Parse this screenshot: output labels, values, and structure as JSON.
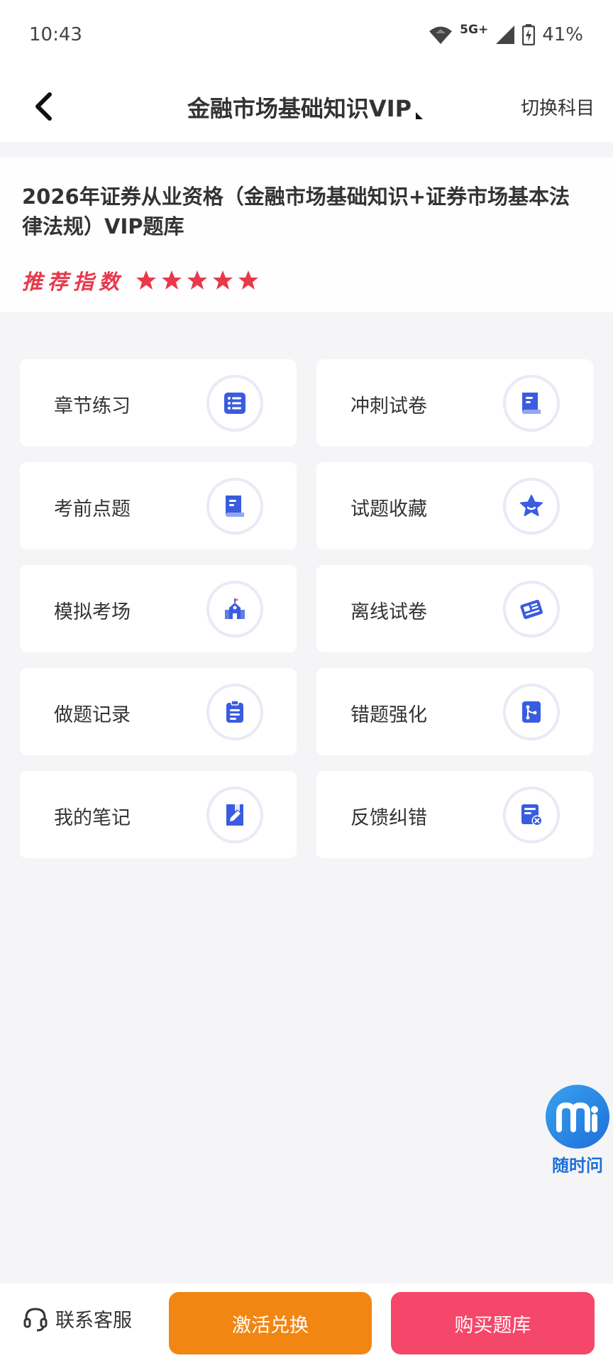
{
  "status_bar": {
    "time": "10:43",
    "network": "5G+",
    "battery": "41%"
  },
  "nav": {
    "title": "金融市场基础知识VIP",
    "switch_label": "切换科目"
  },
  "header": {
    "bank_title": "2026年证券从业资格（金融市场基础知识+证券市场基本法律法规）VIP题库",
    "rating_label": "推荐指数",
    "rating_stars": 5,
    "accent_color": "#e8394b"
  },
  "tiles": [
    {
      "label": "章节练习",
      "icon": "list-icon"
    },
    {
      "label": "冲刺试卷",
      "icon": "document-icon"
    },
    {
      "label": "考前点题",
      "icon": "document-icon"
    },
    {
      "label": "试题收藏",
      "icon": "star-icon"
    },
    {
      "label": "模拟考场",
      "icon": "school-icon"
    },
    {
      "label": "离线试卷",
      "icon": "newspaper-icon"
    },
    {
      "label": "做题记录",
      "icon": "clipboard-icon"
    },
    {
      "label": "错题强化",
      "icon": "branch-icon"
    },
    {
      "label": "我的笔记",
      "icon": "note-pen-icon"
    },
    {
      "label": "反馈纠错",
      "icon": "feedback-icon"
    }
  ],
  "icon_color": "#3a5ce0",
  "float_ask": {
    "label": "随时问"
  },
  "bottom": {
    "service_label": "联系客服",
    "activate_label": "激活兑换",
    "buy_label": "购买题库",
    "activate_color": "#f28613",
    "buy_color": "#f5476a"
  }
}
